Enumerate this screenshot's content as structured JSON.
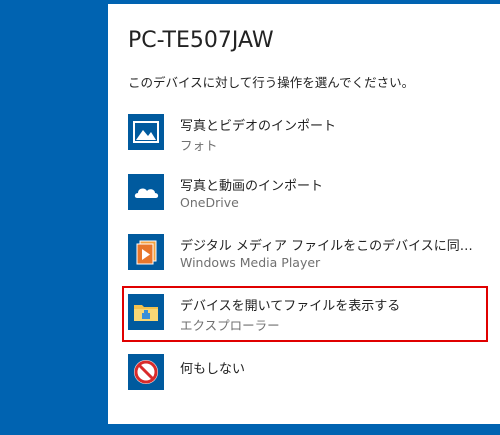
{
  "device": {
    "title": "PC-TE507JAW",
    "prompt": "このデバイスに対して行う操作を選んでください。"
  },
  "options": [
    {
      "label": "写真とビデオのインポート",
      "sub": "フォト",
      "icon": "photos-icon"
    },
    {
      "label": "写真と動画のインポート",
      "sub": "OneDrive",
      "icon": "onedrive-icon"
    },
    {
      "label": "デジタル メディア ファイルをこのデバイスに同期さ...",
      "sub": "Windows Media Player",
      "icon": "media-player-icon"
    },
    {
      "label": "デバイスを開いてファイルを表示する",
      "sub": "エクスプローラー",
      "icon": "folder-icon"
    },
    {
      "label": "何もしない",
      "sub": "",
      "icon": "no-action-icon"
    }
  ],
  "colors": {
    "background": "#0063b1",
    "tile": "#005a9e",
    "highlight": "#e00000"
  }
}
